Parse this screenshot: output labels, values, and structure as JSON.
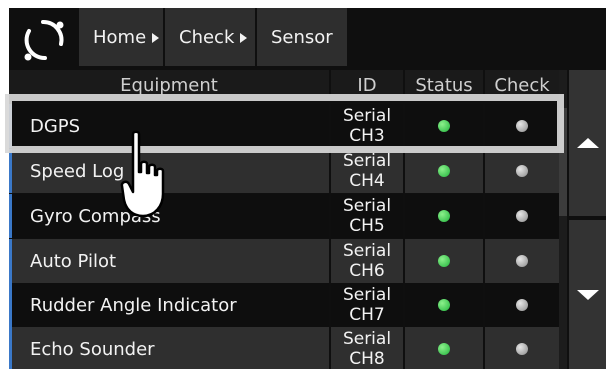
{
  "breadcrumb": {
    "items": [
      {
        "label": "Home"
      },
      {
        "label": "Check"
      },
      {
        "label": "Sensor"
      }
    ]
  },
  "table": {
    "headers": {
      "equipment": "Equipment",
      "id": "ID",
      "status": "Status",
      "check": "Check"
    },
    "rows": [
      {
        "equipment": "DGPS",
        "id_line1": "Serial",
        "id_line2": "CH3",
        "status": "green",
        "check": "gray"
      },
      {
        "equipment": "Speed Log",
        "id_line1": "Serial",
        "id_line2": "CH4",
        "status": "green",
        "check": "gray"
      },
      {
        "equipment": "Gyro Compass",
        "id_line1": "Serial",
        "id_line2": "CH5",
        "status": "green",
        "check": "gray"
      },
      {
        "equipment": "Auto Pilot",
        "id_line1": "Serial",
        "id_line2": "CH6",
        "status": "green",
        "check": "gray"
      },
      {
        "equipment": "Rudder Angle Indicator",
        "id_line1": "Serial",
        "id_line2": "CH7",
        "status": "green",
        "check": "gray"
      },
      {
        "equipment": "Echo Sounder",
        "id_line1": "Serial",
        "id_line2": "CH8",
        "status": "green",
        "check": "gray"
      }
    ]
  },
  "icons": {
    "logo": "ring-logo-icon",
    "up": "arrow-up-icon",
    "down": "arrow-down-icon",
    "pointer": "hand-pointer-icon"
  },
  "colors": {
    "screen_bg": "#0f0f0f",
    "row_dark": "#0e0e0e",
    "row_light": "#2f2f2f",
    "accent": "#3a78c8",
    "status_on": "#21b43c",
    "check_off": "#8a8a8a",
    "highlight": "#d7d7d7"
  }
}
